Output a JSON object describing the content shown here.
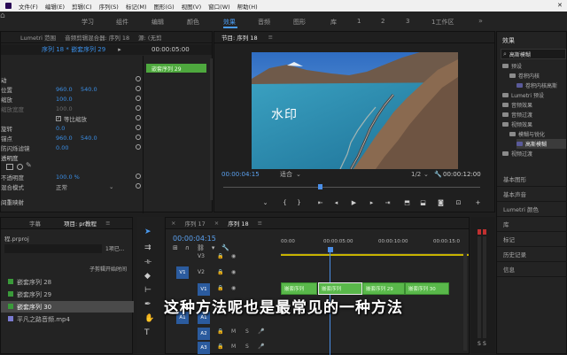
{
  "menu": [
    "文件(F)",
    "编辑(E)",
    "剪辑(C)",
    "序列(S)",
    "标记(M)",
    "图形(G)",
    "视图(V)",
    "窗口(W)",
    "帮助(H)"
  ],
  "workspaces": [
    "学习",
    "组件",
    "编辑",
    "颜色",
    "效果",
    "音频",
    "图形",
    "库",
    "1",
    "2",
    "3",
    "1工作区"
  ],
  "effect_controls": {
    "tabs": [
      "Lumetri 范围",
      "音频剪辑混合器: 序列 18",
      "源: (无剪"
    ],
    "clip_path": "序列 18 * 嵌套序列 29",
    "timecode_in": "00:00:05:00",
    "nested_clip": "嵌套序列 29",
    "rows": [
      {
        "label": "动"
      },
      {
        "label": "位置",
        "v1": "960.0",
        "v2": "540.0"
      },
      {
        "label": "缩放",
        "v1": "100.0"
      },
      {
        "label": "缩放宽度",
        "v1": "100.0"
      },
      {
        "label": "",
        "v1": "",
        "check": "等比缩放"
      },
      {
        "label": "旋转",
        "v1": "0.0"
      },
      {
        "label": "锚点",
        "v1": "960.0",
        "v2": "540.0"
      },
      {
        "label": "防闪烁滤镜",
        "v1": "0.00"
      },
      {
        "label": "透明度"
      },
      {
        "label": "不透明度",
        "v1": "100.0 %"
      },
      {
        "label": "混合模式",
        "v1": "正常"
      },
      {
        "label": "间重映射"
      }
    ]
  },
  "program": {
    "title": "节目: 序列 18",
    "watermark": "水印",
    "timecode": "00:00:04:15",
    "fit": "适合",
    "ratio": "1/2",
    "duration": "00:00:12:00"
  },
  "project": {
    "tabs": [
      "字幕",
      "项目: pr教程"
    ],
    "file": "程.prproj",
    "count": "1项已...",
    "col": "子剪辑开始时间",
    "items": [
      "嵌套序列 28",
      "嵌套序列 29",
      "嵌套序列 30",
      "平凡之路音频.mp4"
    ]
  },
  "timeline": {
    "tabs": [
      "序列 17",
      "序列 18"
    ],
    "timecode": "00:00:04:15",
    "ruler": [
      "00:00",
      "00:00:05:00",
      "00:00:10:00",
      "00:00:15:0"
    ],
    "video_tracks": [
      "V3",
      "V2",
      "V1"
    ],
    "audio_tracks": [
      "A1",
      "A2",
      "A3"
    ],
    "clips": [
      "嵌套序列",
      "嵌套序列",
      "嵌套序列 29",
      "嵌套序列 30"
    ],
    "subtitle": "这种方法呢也是最常见的一种方法"
  },
  "effects_panel": {
    "title": "效果",
    "search": "高斯模糊",
    "tree": [
      {
        "label": "预设",
        "depth": 0
      },
      {
        "label": "卷积内核",
        "depth": 1
      },
      {
        "label": "卷积内核高斯",
        "depth": 2
      },
      {
        "label": "Lumetri 预设",
        "depth": 0
      },
      {
        "label": "音频效果",
        "depth": 0
      },
      {
        "label": "音频过渡",
        "depth": 0
      },
      {
        "label": "视频效果",
        "depth": 0
      },
      {
        "label": "模糊与锐化",
        "depth": 1
      },
      {
        "label": "高斯模糊",
        "depth": 2,
        "selected": true
      },
      {
        "label": "视频过渡",
        "depth": 0
      }
    ],
    "panels": [
      "基本图形",
      "基本声音",
      "Lumetri 颜色",
      "库",
      "标记",
      "历史记录",
      "信息"
    ]
  },
  "audio_meter": {
    "labels": [
      "S",
      "S"
    ]
  }
}
